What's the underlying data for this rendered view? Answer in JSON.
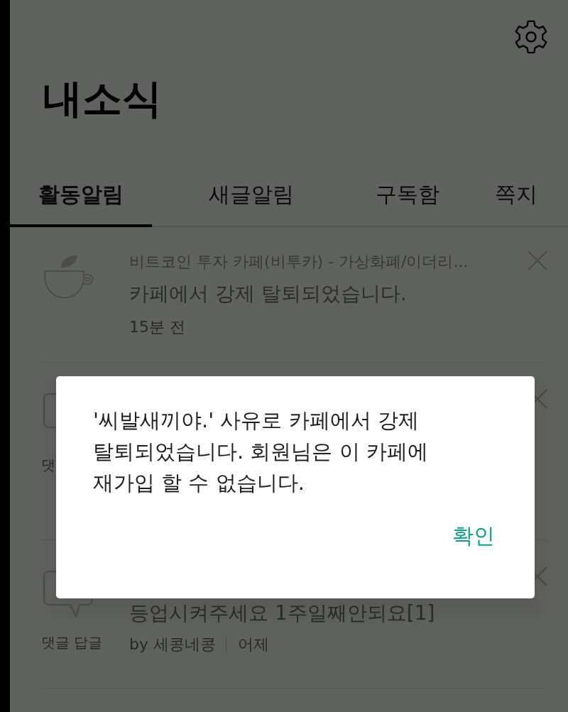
{
  "header": {
    "title": "내소식"
  },
  "tabs": [
    {
      "label": "활동알림",
      "selected": true
    },
    {
      "label": "새글알림",
      "selected": false
    },
    {
      "label": "구독함",
      "selected": false
    },
    {
      "label": "쪽지",
      "selected": false
    }
  ],
  "notifications": [
    {
      "kind": "cafe",
      "cafe": "비트코인 투자 카페(비투카) - 가상화폐/이더리...",
      "message": "카페에서 강제 탈퇴되었습니다.",
      "time": "15분 전"
    },
    {
      "kind": "comment",
      "type_label": "댓"
    },
    {
      "kind": "comment",
      "type_label": "댓글 답글",
      "message": "등업시켜주세요 1주일째안되요[1]",
      "author": "by 세콩네콩",
      "time": "어제"
    }
  ],
  "dialog": {
    "message": "'씨발새끼야.' 사유로 카페에서 강제 탈퇴되었습니다. 회원님은 이 카페에 재가입 할 수 없습니다.",
    "button": "확인"
  }
}
